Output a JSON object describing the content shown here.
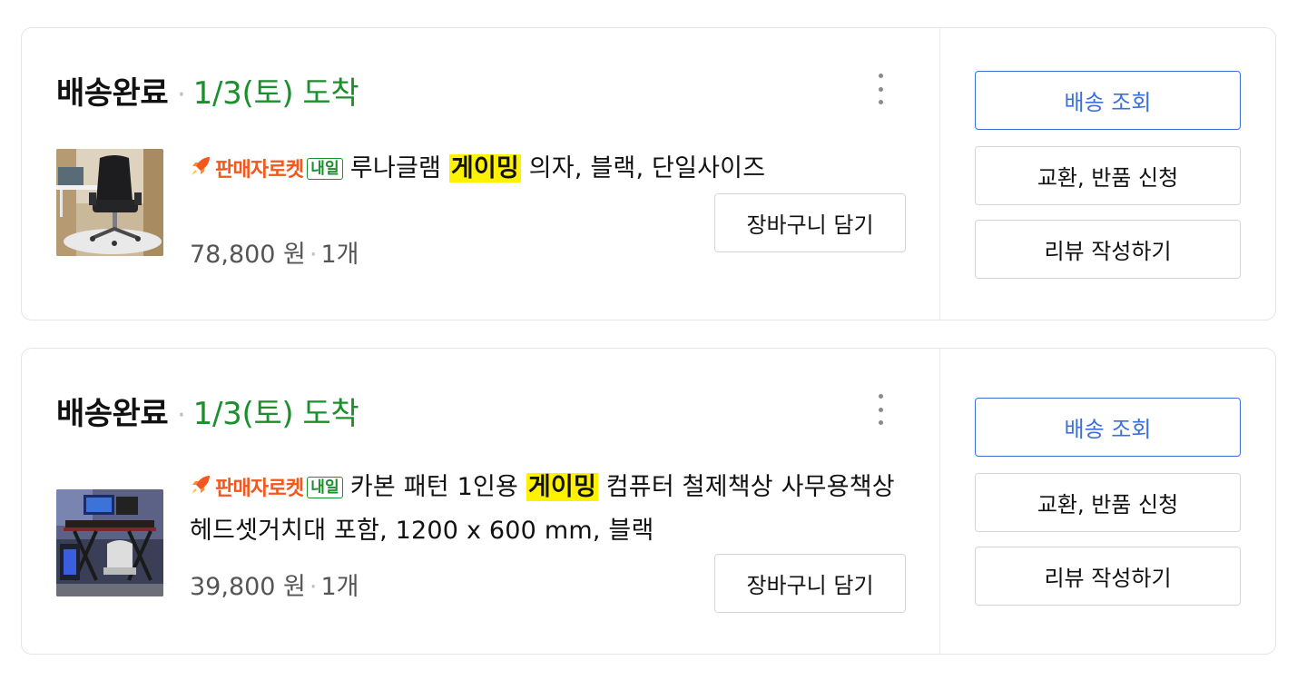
{
  "colors": {
    "arrival_green": "#1b8f2e",
    "seller_orange": "#f2571e",
    "highlight_yellow": "#fff200",
    "primary_blue": "#3b6fd9"
  },
  "orders": [
    {
      "status": "배송완료",
      "separator": "·",
      "arrival_date": "1/3(토)",
      "arrival_word": "도착",
      "thumbnail_icon": "gaming-chair-photo",
      "badge_seller": "판매자로켓",
      "badge_tomorrow": "내일",
      "title_before": "루나글램 ",
      "title_highlight": "게이밍",
      "title_after": " 의자, 블랙, 단일사이즈",
      "price": "78,800 원",
      "quantity": "1개",
      "cart_label": "장바구니 담기",
      "actions": {
        "track": "배송 조회",
        "return": "교환, 반품 신청",
        "review": "리뷰 작성하기"
      }
    },
    {
      "status": "배송완료",
      "separator": "·",
      "arrival_date": "1/3(토)",
      "arrival_word": "도착",
      "thumbnail_icon": "gaming-desk-photo",
      "badge_seller": "판매자로켓",
      "badge_tomorrow": "내일",
      "title_before": "카본 패턴 1인용 ",
      "title_highlight": "게이밍",
      "title_after": " 컴퓨터 철제책상 사무용책상 헤드셋거치대 포함, 1200 x 600 mm, 블랙",
      "price": "39,800 원",
      "quantity": "1개",
      "cart_label": "장바구니 담기",
      "actions": {
        "track": "배송 조회",
        "return": "교환, 반품 신청",
        "review": "리뷰 작성하기"
      }
    }
  ]
}
